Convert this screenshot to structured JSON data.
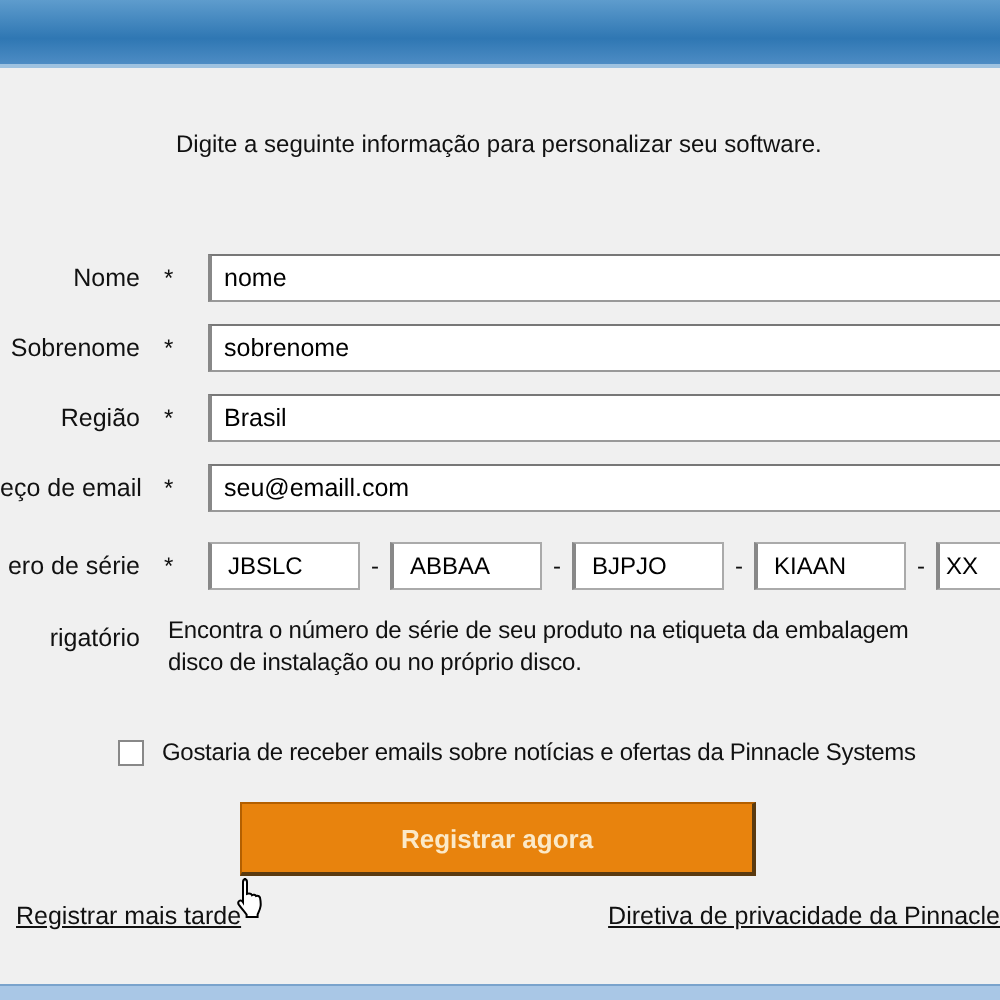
{
  "intro": "Digite a seguinte informação para personalizar seu software.",
  "fields": [
    {
      "label": "Nome",
      "marker": "*",
      "value": "nome"
    },
    {
      "label": "Sobrenome",
      "marker": "*",
      "value": "sobrenome"
    },
    {
      "label": "Região",
      "marker": "*",
      "value": "Brasil"
    },
    {
      "label": "eço de email",
      "marker": "*",
      "value": "seu@emaill.com"
    }
  ],
  "serial": {
    "label": "ero de série",
    "marker": "*",
    "parts": [
      "JBSLC",
      "ABBAA",
      "BJPJO",
      "KIAAN",
      "XX"
    ],
    "separator": "-"
  },
  "required_note": "rigatório",
  "hint": "Encontra o número de série de seu produto na etiqueta da embalagem\ndisco de instalação ou no próprio disco.",
  "newsletter": {
    "label": "Gostaria de receber emails sobre notícias e ofertas da Pinnacle Systems",
    "checked": false
  },
  "register_button": "Registrar agora",
  "links": [
    "Registrar mais tarde",
    "Diretiva de privacidade da Pinnacle"
  ]
}
